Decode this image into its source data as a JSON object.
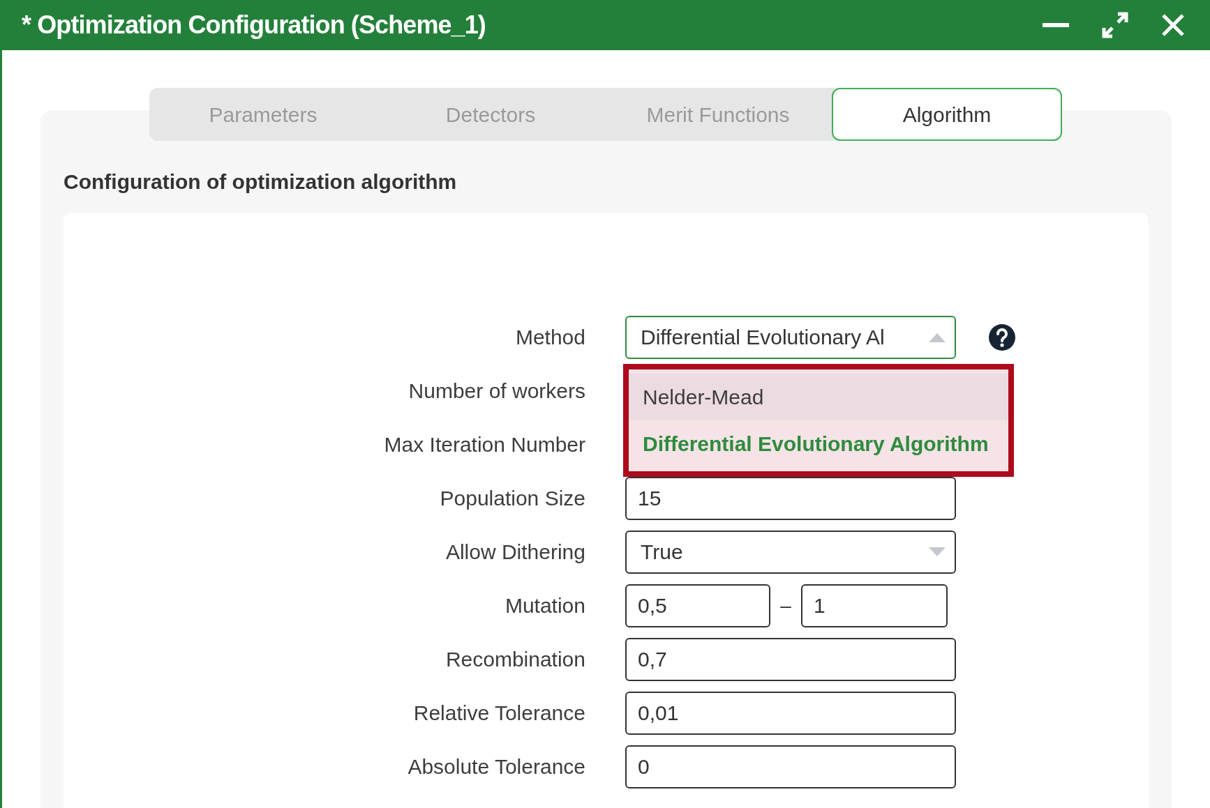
{
  "window": {
    "title": "* Optimization Configuration (Scheme_1)"
  },
  "tabs": [
    {
      "label": "Parameters",
      "selected": false
    },
    {
      "label": "Detectors",
      "selected": false
    },
    {
      "label": "Merit Functions",
      "selected": false
    },
    {
      "label": "Algorithm",
      "selected": true
    }
  ],
  "section": {
    "heading": "Configuration of optimization algorithm"
  },
  "rows": [
    {
      "label": "Method",
      "kind": "select",
      "value": "Differential Evolutionary Al",
      "expanded": true,
      "help": true,
      "options": [
        {
          "label": "Nelder-Mead",
          "selected": false
        },
        {
          "label": "Differential Evolutionary Algorithm",
          "selected": true
        }
      ]
    },
    {
      "label": "Number of workers",
      "kind": "covered"
    },
    {
      "label": "Max Iteration Number",
      "kind": "covered"
    },
    {
      "label": "Population Size",
      "kind": "input",
      "value": "15"
    },
    {
      "label": "Allow Dithering",
      "kind": "select",
      "value": "True",
      "expanded": false
    },
    {
      "label": "Mutation",
      "kind": "range",
      "low": "0,5",
      "separator": "–",
      "high": "1"
    },
    {
      "label": "Recombination",
      "kind": "input",
      "value": "0,7"
    },
    {
      "label": "Relative Tolerance",
      "kind": "input",
      "value": "0,01"
    },
    {
      "label": "Absolute Tolerance",
      "kind": "input",
      "value": "0"
    }
  ]
}
